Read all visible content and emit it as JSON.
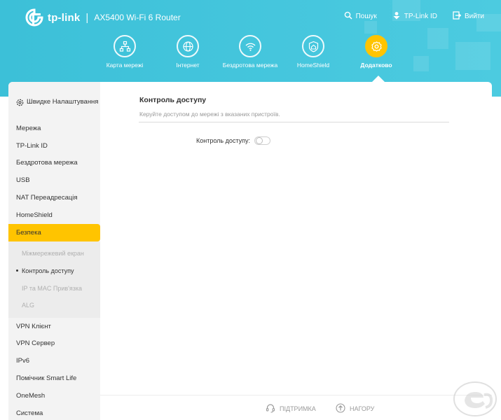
{
  "header": {
    "brand": "tp-link",
    "separator": "|",
    "model": "AX5400 Wi-Fi 6 Router",
    "top_links": [
      {
        "label": "Пошук",
        "icon": "search-icon"
      },
      {
        "label": "TP-Link ID",
        "icon": "tplink-id-icon"
      },
      {
        "label": "Вийти",
        "icon": "logout-icon"
      }
    ]
  },
  "nav": {
    "items": [
      {
        "label": "Карта мережі",
        "icon": "network-map-icon"
      },
      {
        "label": "Інтернет",
        "icon": "globe-icon"
      },
      {
        "label": "Бездротова мережа",
        "icon": "wifi-icon"
      },
      {
        "label": "HomeShield",
        "icon": "home-shield-icon"
      },
      {
        "label": "Додатково",
        "icon": "gear-icon",
        "active": true
      }
    ]
  },
  "sidebar": {
    "quick_setup": "Швидке Налаштування",
    "items": [
      "Мережа",
      "TP-Link ID",
      "Бездротова мережа",
      "USB",
      "NAT Переадресація",
      "HomeShield",
      "Безпека"
    ],
    "selected": "Безпека",
    "submenu": [
      "Міжмережевий екран",
      "Контроль доступу",
      "IP та MAC Прив'язка",
      "ALG"
    ],
    "submenu_current": "Контроль доступу",
    "items_after": [
      "VPN Клієнт",
      "VPN Сервер",
      "IPv6",
      "Помічник Smart Life",
      "OneMesh",
      "Система"
    ]
  },
  "content": {
    "title": "Контроль доступу",
    "description": "Керуйте доступом до мережі з вказаних пристроїв.",
    "field_label": "Контроль доступу:",
    "toggle_on": false
  },
  "footer": {
    "support": "ПІДТРИМКА",
    "back_to_top": "НАГОРУ"
  },
  "colors": {
    "header": "#45c6dd",
    "accent": "#ffc400",
    "sidebar_bg": "#f3f3f3"
  }
}
